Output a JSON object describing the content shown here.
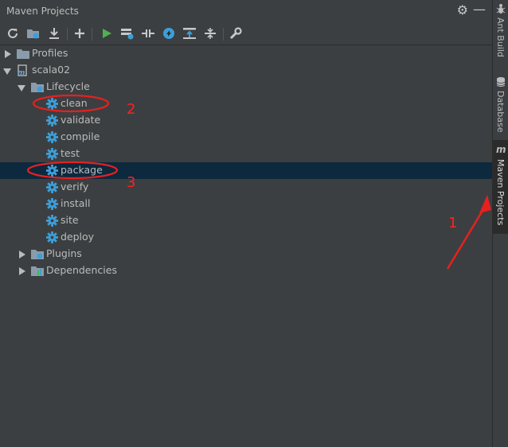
{
  "panel": {
    "title": "Maven Projects"
  },
  "colors": {
    "background": "#3c3f41",
    "selection": "#0d293e",
    "text": "#bbbbbb",
    "gear_blue": "#3d9fd9",
    "run_green": "#4fb04f",
    "annotation_red": "#ff2020"
  },
  "toolbar": {
    "buttons": [
      "reimport-icon",
      "generate-sources-icon",
      "download-icon",
      "add-icon",
      "run-icon",
      "run-config-icon",
      "toggle-offline-icon",
      "skip-tests-icon",
      "show-dependencies-icon",
      "collapse-all-icon",
      "settings-wrench-icon"
    ]
  },
  "tree": {
    "profiles": "Profiles",
    "project": "scala02",
    "lifecycle": "Lifecycle",
    "goals": [
      "clean",
      "validate",
      "compile",
      "test",
      "package",
      "verify",
      "install",
      "site",
      "deploy"
    ],
    "plugins": "Plugins",
    "dependencies": "Dependencies",
    "selected_goal": "package"
  },
  "stripe": {
    "tabs": [
      {
        "label": "Ant Build",
        "icon": "ant-icon"
      },
      {
        "label": "Database",
        "icon": "database-icon"
      },
      {
        "label": "Maven Projects",
        "icon": "maven-icon"
      }
    ]
  },
  "annotations": [
    "1",
    "2",
    "3"
  ]
}
